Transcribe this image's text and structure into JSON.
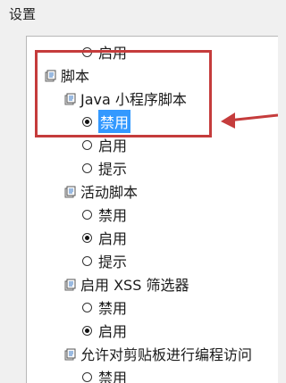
{
  "group_label": "设置",
  "tree": {
    "top_option": "启用",
    "scripts": {
      "label": "脚本",
      "java_applet": {
        "label": "Java 小程序脚本",
        "options": [
          "禁用",
          "启用",
          "提示"
        ],
        "selected": "禁用"
      },
      "active_scripting": {
        "label": "活动脚本",
        "options": [
          "禁用",
          "启用",
          "提示"
        ],
        "selected": "启用"
      },
      "xss_filter": {
        "label": "启用 XSS 筛选器",
        "options": [
          "禁用",
          "启用"
        ],
        "selected": "启用"
      },
      "clipboard": {
        "label": "允许对剪贴板进行编程访问",
        "options": [
          "禁用"
        ]
      }
    }
  },
  "colors": {
    "highlight": "#c53c3c",
    "selection": "#3399ff"
  },
  "icons": {
    "node": "settings-node-icon",
    "radio": "radio-button"
  }
}
